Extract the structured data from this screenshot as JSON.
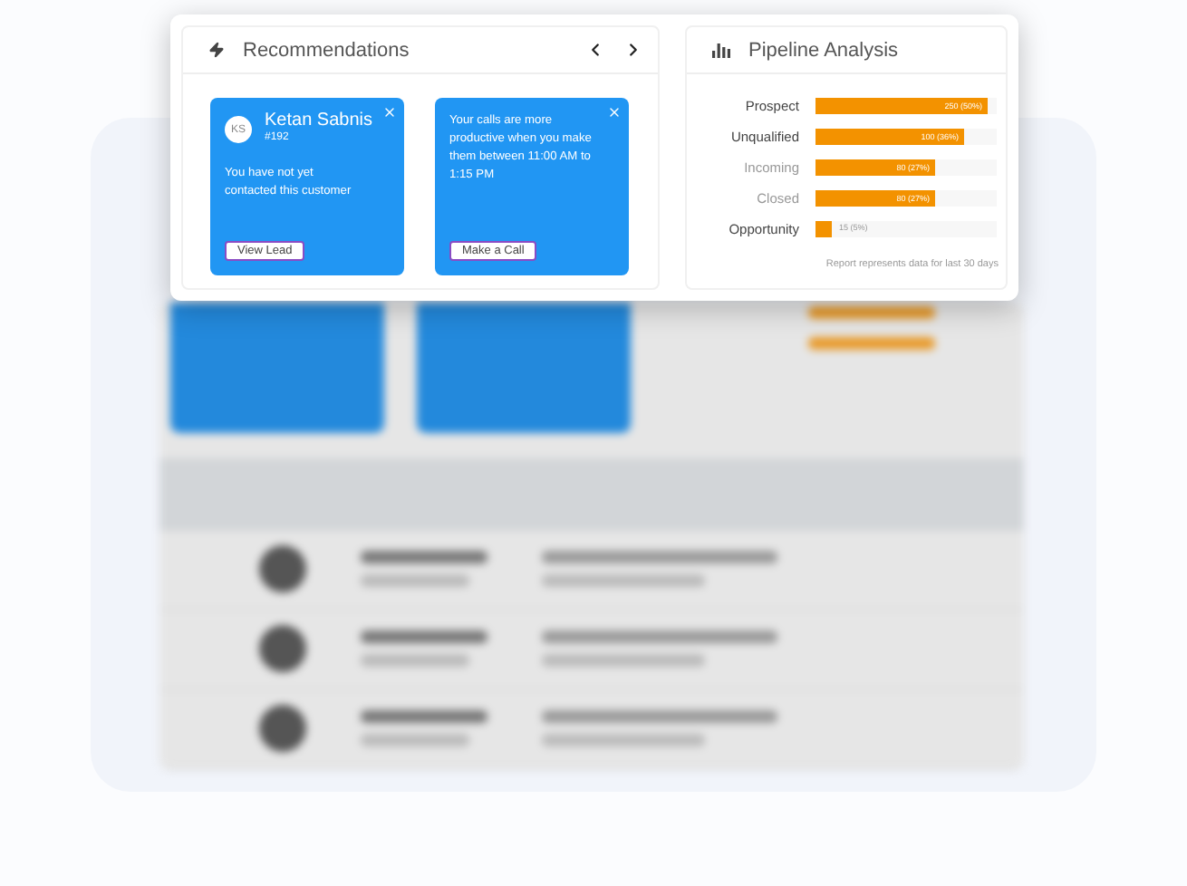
{
  "recommendations": {
    "title": "Recommendations",
    "cards": [
      {
        "kind": "lead",
        "initials": "KS",
        "name": "Ketan Sabnis",
        "id": "#192",
        "message": "You have not yet contacted this customer",
        "action": "View Lead"
      },
      {
        "kind": "tip",
        "message": "Your calls are more productive when you make them between 11:00 AM to 1:15 PM",
        "action": "Make a Call"
      }
    ]
  },
  "pipeline": {
    "title": "Pipeline Analysis",
    "rows": [
      {
        "label": "Prospect",
        "value": "250 (50%)",
        "level": 0.95,
        "muted": false
      },
      {
        "label": "Unqualified",
        "value": "100 (36%)",
        "level": 0.82,
        "muted": false
      },
      {
        "label": "Incoming",
        "value": "80 (27%)",
        "level": 0.66,
        "muted": true
      },
      {
        "label": "Closed",
        "value": "80 (27%)",
        "level": 0.66,
        "muted": true
      },
      {
        "label": "Opportunity",
        "value": "15 (5%)",
        "level": 0.09,
        "muted": false
      }
    ],
    "footnote": "Report represents data for last 30 days"
  }
}
